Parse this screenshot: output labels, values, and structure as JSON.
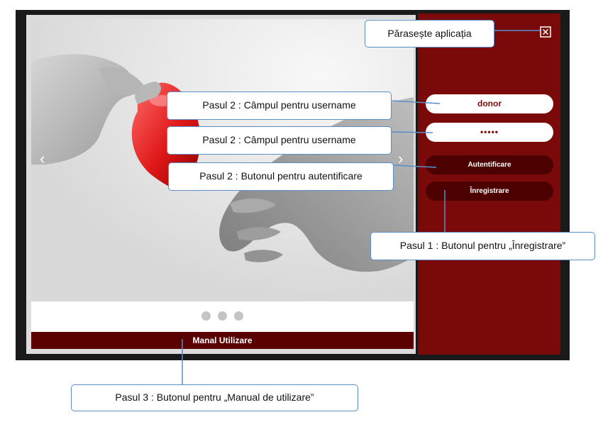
{
  "login": {
    "username_value": "donor",
    "password_value": "•••••",
    "login_label": "Autentificare",
    "register_label": "Înregistrare"
  },
  "manual": {
    "label": "Manal Utilizare"
  },
  "carousel": {
    "prev_glyph": "‹",
    "next_glyph": "›",
    "dots": 3,
    "active_dot": 0
  },
  "callouts": {
    "exit": "Părasește aplicația",
    "username": "Pasul 2 : Câmpul pentru username",
    "password": "Pasul 2 : Câmpul pentru username",
    "login": "Pasul 2 : Butonul pentru autentificare",
    "register": "Pasul 1 : Butonul pentru „Înregistrare”",
    "manual": "Pasul 3 : Butonul pentru „Manual de utilizare”"
  },
  "colors": {
    "sidebar": "#7a0a0a",
    "button_dark": "#4d0000",
    "manual_bar": "#5b0000",
    "callout_border": "#5b8ec9"
  },
  "icons": {
    "close": "close-box-icon"
  }
}
